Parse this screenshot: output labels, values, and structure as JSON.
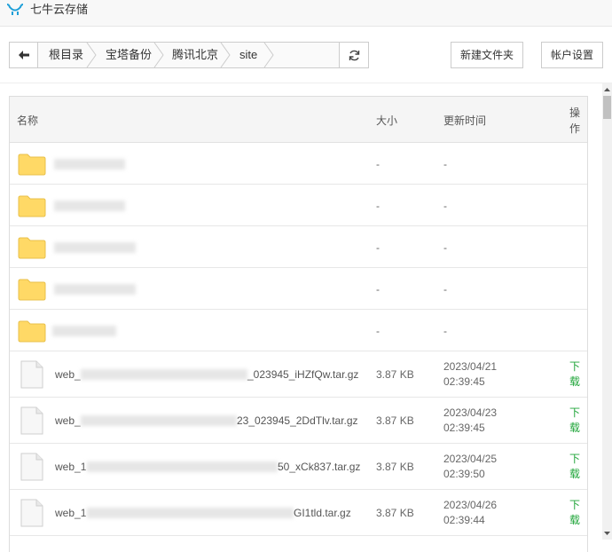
{
  "window": {
    "title": "七牛云存储"
  },
  "breadcrumb": {
    "items": [
      "根目录",
      "宝塔备份",
      "腾讯北京",
      "site"
    ]
  },
  "buttons": {
    "new_folder": "新建文件夹",
    "account_settings": "帐户设置"
  },
  "table": {
    "headers": {
      "name": "名称",
      "size": "大小",
      "modified": "更新时间",
      "action_1": "操",
      "action_2": "作"
    },
    "folders": [
      {
        "size": "-",
        "modified": "-"
      },
      {
        "size": "-",
        "modified": "-"
      },
      {
        "size": "-",
        "modified": "-"
      },
      {
        "size": "-",
        "modified": "-"
      },
      {
        "size": "-",
        "modified": "-"
      }
    ],
    "files": [
      {
        "name_prefix": "web_",
        "name_suffix": "_023945_iHZfQw.tar.gz",
        "size": "3.87 KB",
        "date": "2023/04/21",
        "time": "02:39:45",
        "action_1": "下",
        "action_2": "载"
      },
      {
        "name_prefix": "web_",
        "name_suffix": "23_023945_2DdTlv.tar.gz",
        "size": "3.87 KB",
        "date": "2023/04/23",
        "time": "02:39:45",
        "action_1": "下",
        "action_2": "载"
      },
      {
        "name_prefix": "web_1",
        "name_suffix": "50_xCk837.tar.gz",
        "size": "3.87 KB",
        "date": "2023/04/25",
        "time": "02:39:50",
        "action_1": "下",
        "action_2": "载"
      },
      {
        "name_prefix": "web_1",
        "name_suffix": "GI1tld.tar.gz",
        "size": "3.87 KB",
        "date": "2023/04/26",
        "time": "02:39:44",
        "action_1": "下",
        "action_2": "载"
      }
    ]
  },
  "colors": {
    "accent_green": "#20a53a",
    "folder_yellow": "#ffd966",
    "logo_blue": "#1e9fd8"
  },
  "icons": [
    "qiniu-logo-icon",
    "back-arrow-icon",
    "chevron-separator-icon",
    "refresh-icon",
    "folder-icon",
    "file-icon",
    "scroll-up-icon",
    "scroll-down-icon"
  ]
}
